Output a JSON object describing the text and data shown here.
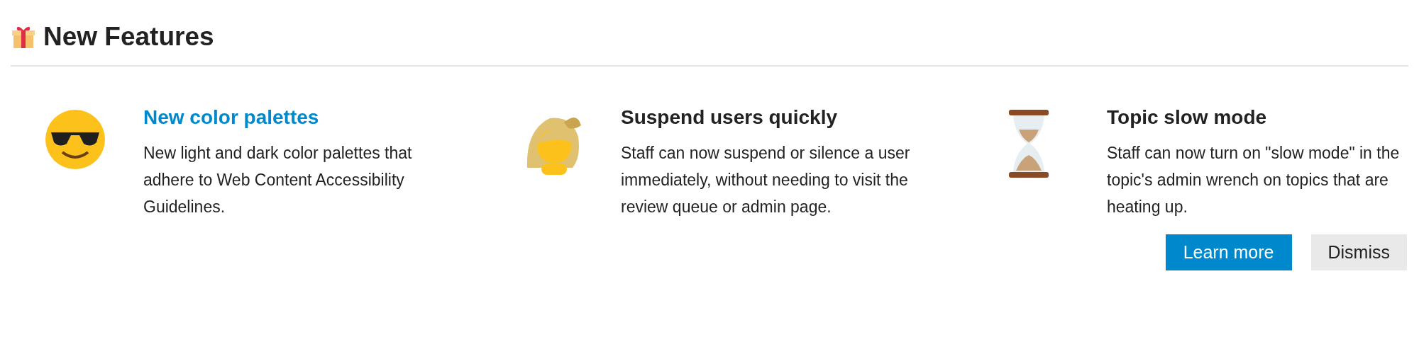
{
  "header": {
    "title": "New Features"
  },
  "features": [
    {
      "title": "New color palettes",
      "kind": "link",
      "description": "New light and dark color palettes that adhere to Web Content Accessibility Guidelines."
    },
    {
      "title": "Suspend users quickly",
      "kind": "plain",
      "description": "Staff can now suspend or silence a user immediately, without needing to visit the review queue or admin page."
    },
    {
      "title": "Topic slow mode",
      "kind": "plain",
      "description": "Staff can now turn on \"slow mode\" in the topic's admin wrench on topics that are heating up."
    }
  ],
  "buttons": [
    {
      "label": "Learn more",
      "kind": "primary"
    },
    {
      "label": "Dismiss",
      "kind": "secondary"
    }
  ]
}
